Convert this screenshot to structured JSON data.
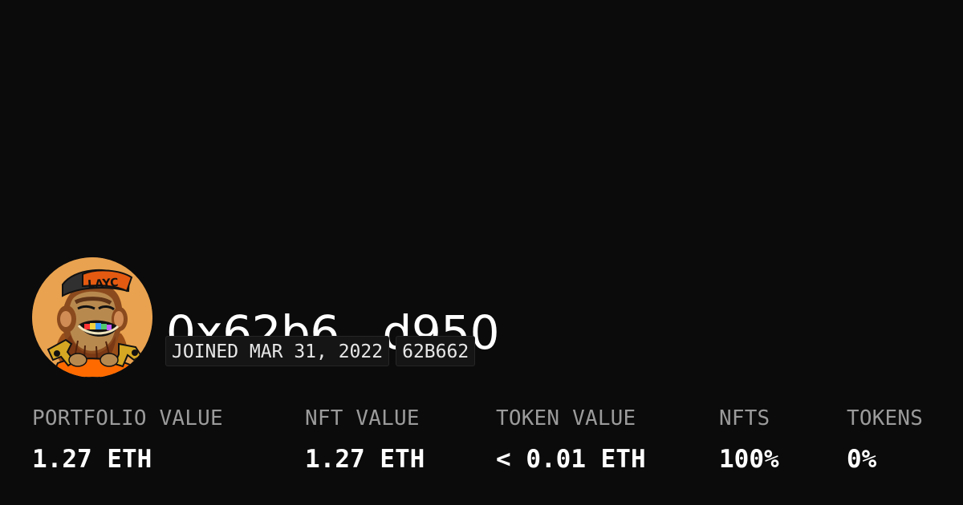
{
  "profile": {
    "wallet_address": "0x62b6...d950",
    "joined": "JOINED MAR 31, 2022",
    "short_id": "62B662",
    "avatar": {
      "icon": "ape-avatar-icon",
      "hat_text": "LAYC",
      "background": "#e9a24f"
    }
  },
  "stats": [
    {
      "label": "PORTFOLIO VALUE",
      "value": "1.27 ETH"
    },
    {
      "label": "NFT VALUE",
      "value": "1.27 ETH"
    },
    {
      "label": "TOKEN VALUE",
      "value": "< 0.01 ETH"
    },
    {
      "label": "NFTS",
      "value": "100%"
    },
    {
      "label": "TOKENS",
      "value": "0%"
    }
  ],
  "colors": {
    "background": "#0b0b0b",
    "text": "#ffffff",
    "muted": "#9b9b9b",
    "badge_background": "#151515"
  }
}
